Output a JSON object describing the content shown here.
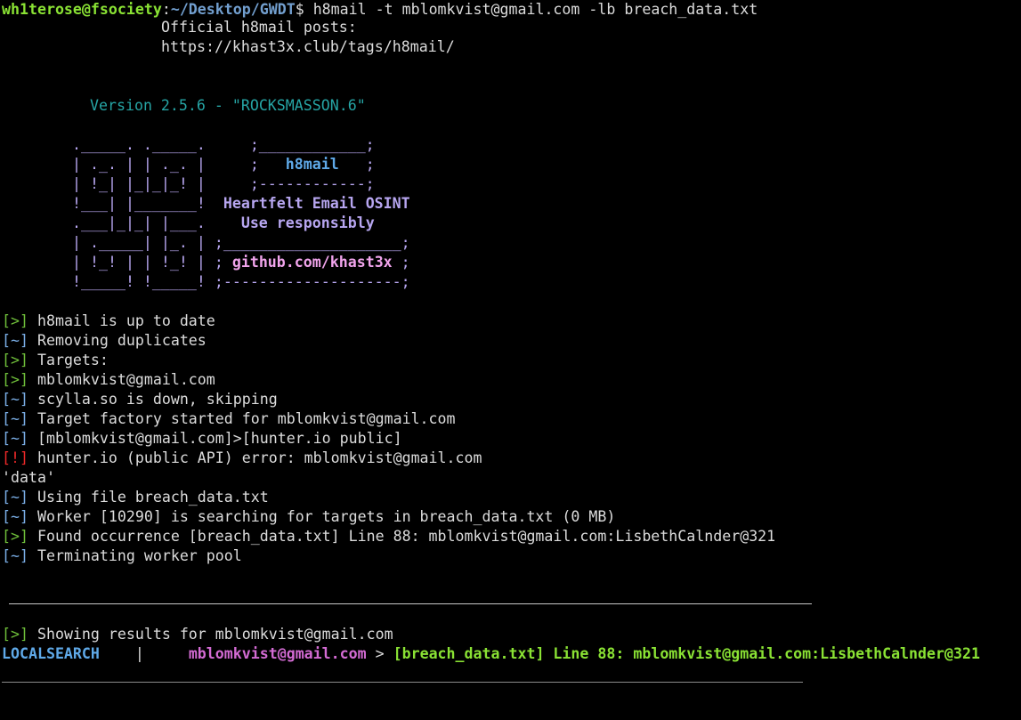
{
  "prompt": {
    "user_host": "wh1terose@fsociety",
    "separator": ":",
    "path": "~/Desktop/GWDT",
    "symbol": "$",
    "command": " h8mail -t mblomkvist@gmail.com -lb breach_data.txt"
  },
  "header": {
    "posts_label": "Official h8mail posts:",
    "posts_url": "https://khast3x.club/tags/h8mail/",
    "version": "Version 2.5.6 - \"ROCKSMASSON.6\""
  },
  "logo": {
    "rows": [
      {
        "art": "._____. ._____.     ",
        "side": ";____________;"
      },
      {
        "art": "| ._. | | ._. |     ",
        "side": ";   ",
        "side_bold": "h8mail",
        "side_end": "   ;"
      },
      {
        "art": "| !_| |_|_|_! |     ",
        "side": ";------------;"
      },
      {
        "art": "!___| |_______!  ",
        "side_bold": "Heartfelt Email OSINT"
      },
      {
        "art": ".___|_|_| |___.    ",
        "side_bold": "Use responsibly"
      },
      {
        "art": "| ._____| |_. | ",
        "side": ";____________________;"
      },
      {
        "art": "| !_! | | !_! | ",
        "side": "; ",
        "side_bold": "github.com/khast3x",
        "side_end": " ;"
      },
      {
        "art": "!_____! !_____! ",
        "side": ";--------------------;"
      }
    ]
  },
  "log": [
    {
      "marker": "[>]",
      "kind": "ok",
      "text": " h8mail is up to date"
    },
    {
      "marker": "[~]",
      "kind": "info",
      "text": " Removing duplicates"
    },
    {
      "marker": "[>]",
      "kind": "ok",
      "text": " Targets:"
    },
    {
      "marker": "[>]",
      "kind": "ok",
      "text": " mblomkvist@gmail.com"
    },
    {
      "marker": "[~]",
      "kind": "info",
      "text": " scylla.so is down, skipping"
    },
    {
      "marker": "[~]",
      "kind": "info",
      "text": " Target factory started for mblomkvist@gmail.com"
    },
    {
      "marker": "[~]",
      "kind": "info",
      "text": " [mblomkvist@gmail.com]>[hunter.io public]"
    },
    {
      "marker": "[!]",
      "kind": "error",
      "text": " hunter.io (public API) error: mblomkvist@gmail.com"
    },
    {
      "marker": "",
      "kind": "plain",
      "text": "'data'"
    },
    {
      "marker": "[~]",
      "kind": "info",
      "text": " Using file breach_data.txt"
    },
    {
      "marker": "[~]",
      "kind": "info",
      "text": " Worker [10290] is searching for targets in breach_data.txt (0 MB)"
    },
    {
      "marker": "[>]",
      "kind": "ok",
      "text": " Found occurrence [breach_data.txt] Line 88: mblomkvist@gmail.com:LisbethCalnder@321"
    },
    {
      "marker": "[~]",
      "kind": "info",
      "text": " Terminating worker pool"
    }
  ],
  "results": {
    "marker": "[>]",
    "heading": " Showing results for mblomkvist@gmail.com",
    "source": "LOCALSEARCH",
    "pipe": "    |     ",
    "target": "mblomkvist@gmail.com",
    "arrow": " > ",
    "finding": "[breach_data.txt] Line 88: mblomkvist@gmail.com:LisbethCalnder@321"
  },
  "colors": {
    "background": "#000000",
    "prompt_user": "#8ae234",
    "prompt_path": "#729fcf",
    "logo": "#b7a6f0",
    "ok_marker": "#6fbf3a",
    "info_marker": "#7aaee6",
    "error_marker": "#ef2929"
  }
}
